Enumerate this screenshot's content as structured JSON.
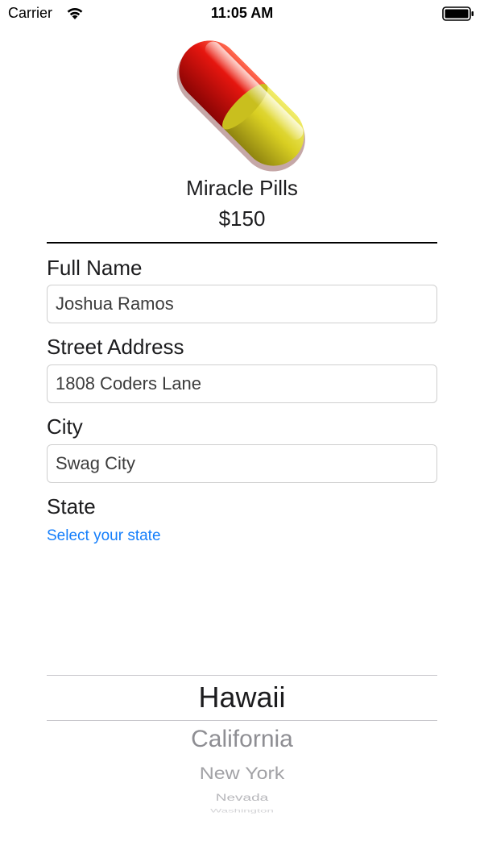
{
  "status_bar": {
    "carrier": "Carrier",
    "time": "11:05 AM",
    "wifi_icon": "wifi-icon",
    "battery_icon": "battery-icon"
  },
  "product": {
    "image_icon": "pill-icon",
    "name": "Miracle Pills",
    "price": "$150"
  },
  "form": {
    "full_name": {
      "label": "Full Name",
      "value": "Joshua Ramos"
    },
    "street_address": {
      "label": "Street Address",
      "value": "1808 Coders Lane"
    },
    "city": {
      "label": "City",
      "value": "Swag City"
    },
    "state": {
      "label": "State",
      "link_text": "Select your state"
    }
  },
  "state_picker": {
    "selected": "Hawaii",
    "options_below": [
      "California",
      "New York",
      "Nevada",
      "Washington"
    ]
  },
  "colors": {
    "link": "#147efb",
    "pill_red": "#e0100c",
    "pill_yellow": "#d9cf22",
    "divider": "#000000"
  }
}
